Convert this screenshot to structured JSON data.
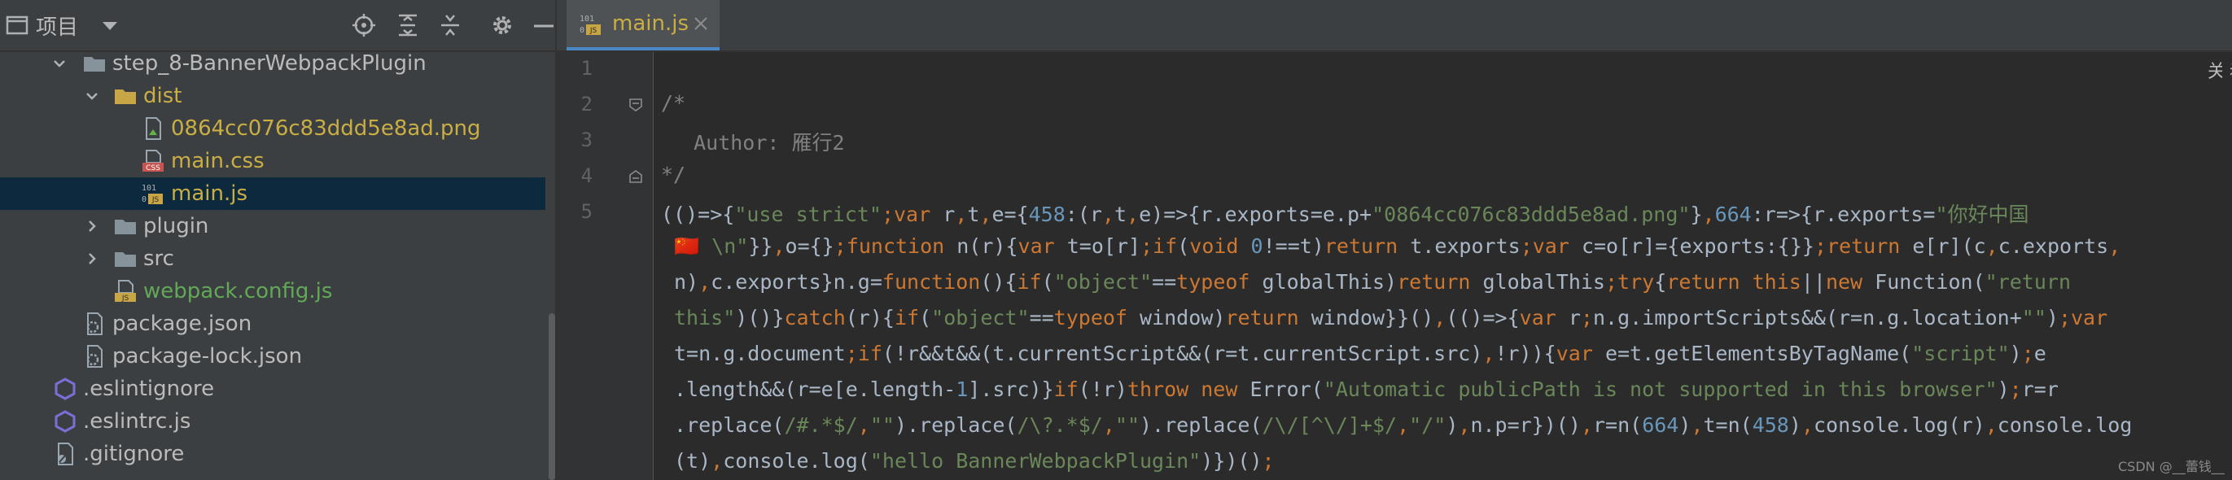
{
  "panel": {
    "title": "项目",
    "toolbar_icons": [
      "locate-icon",
      "expand-all-icon",
      "collapse-all-icon",
      "gear-icon",
      "hide-icon"
    ]
  },
  "tree": [
    {
      "label": "step_8-BannerWebpackPlugin",
      "depth": 1,
      "kind": "folder",
      "expanded": true,
      "color": "default"
    },
    {
      "label": "dist",
      "depth": 2,
      "kind": "folder",
      "expanded": true,
      "color": "yellow"
    },
    {
      "label": "0864cc076c83ddd5e8ad.png",
      "depth": 3,
      "kind": "image-file",
      "color": "yellow"
    },
    {
      "label": "main.css",
      "depth": 3,
      "kind": "css-file",
      "color": "yellow"
    },
    {
      "label": "main.js",
      "depth": 3,
      "kind": "js-file",
      "color": "yellow",
      "selected": true
    },
    {
      "label": "plugin",
      "depth": 2,
      "kind": "folder",
      "expanded": false,
      "color": "default"
    },
    {
      "label": "src",
      "depth": 2,
      "kind": "folder",
      "expanded": false,
      "color": "default"
    },
    {
      "label": "webpack.config.js",
      "depth": 2,
      "kind": "js-file",
      "color": "green"
    },
    {
      "label": "package.json",
      "depth": 1,
      "kind": "json-file",
      "color": "default"
    },
    {
      "label": "package-lock.json",
      "depth": 1,
      "kind": "json-file",
      "color": "default"
    },
    {
      "label": ".eslintignore",
      "depth": 0,
      "kind": "eslint-file",
      "color": "default"
    },
    {
      "label": ".eslintrc.js",
      "depth": 0,
      "kind": "eslint-file",
      "color": "default"
    },
    {
      "label": ".gitignore",
      "depth": 0,
      "kind": "gitignore-file",
      "color": "default"
    }
  ],
  "editor": {
    "tab_label": "main.js",
    "right_hint": "关闭",
    "line_numbers": [
      "1",
      "2",
      "3",
      "4",
      "5"
    ],
    "line1": "",
    "line2": "/*",
    "line3": "  Author: 雁行2",
    "line4": "*/",
    "code_lines": [
      [
        [
          "p",
          "(()=>{"
        ],
        [
          "s",
          "\"use strict\""
        ],
        [
          "k",
          ";var "
        ],
        [
          "p",
          "r"
        ],
        [
          "k",
          ","
        ],
        [
          "p",
          "t"
        ],
        [
          "k",
          ","
        ],
        [
          "p",
          "e={"
        ],
        [
          "n",
          "458"
        ],
        [
          "p",
          ":(r"
        ],
        [
          "k",
          ","
        ],
        [
          "p",
          "t"
        ],
        [
          "k",
          ","
        ],
        [
          "p",
          "e)=>{r.exports=e.p+"
        ],
        [
          "s",
          "\"0864cc076c83ddd5e8ad.png\""
        ],
        [
          "p",
          "}"
        ],
        [
          "k",
          ","
        ],
        [
          "n",
          "664"
        ],
        [
          "p",
          ":r=>{r.exports="
        ],
        [
          "s",
          "\"你好中国"
        ]
      ],
      [
        [
          "s",
          "🇨🇳 \\n\""
        ],
        [
          "p",
          "}}"
        ],
        [
          "k",
          ","
        ],
        [
          "p",
          "o={}"
        ],
        [
          "k",
          ";function "
        ],
        [
          "p",
          "n(r){"
        ],
        [
          "k",
          "var "
        ],
        [
          "p",
          "t=o[r]"
        ],
        [
          "k",
          ";if"
        ],
        [
          "p",
          "("
        ],
        [
          "k",
          "void "
        ],
        [
          "n",
          "0"
        ],
        [
          "p",
          "!==t)"
        ],
        [
          "k",
          "return "
        ],
        [
          "p",
          "t.exports"
        ],
        [
          "k",
          ";var "
        ],
        [
          "p",
          "c=o[r]={exports:{}}"
        ],
        [
          "k",
          ";return "
        ],
        [
          "p",
          "e[r](c"
        ],
        [
          "k",
          ","
        ],
        [
          "p",
          "c.exports"
        ],
        [
          "k",
          ","
        ]
      ],
      [
        [
          "p",
          "n)"
        ],
        [
          "k",
          ","
        ],
        [
          "p",
          "c.exports}n.g="
        ],
        [
          "k",
          "function"
        ],
        [
          "p",
          "(){"
        ],
        [
          "k",
          "if"
        ],
        [
          "p",
          "("
        ],
        [
          "s",
          "\"object\""
        ],
        [
          "p",
          "=="
        ],
        [
          "k",
          "typeof "
        ],
        [
          "p",
          "globalThis)"
        ],
        [
          "k",
          "return "
        ],
        [
          "p",
          "globalThis"
        ],
        [
          "k",
          ";try"
        ],
        [
          "p",
          "{"
        ],
        [
          "k",
          "return this"
        ],
        [
          "p",
          "||"
        ],
        [
          "k",
          "new "
        ],
        [
          "p",
          "Function("
        ],
        [
          "s",
          "\"return"
        ]
      ],
      [
        [
          "s",
          "this\""
        ],
        [
          "p",
          ")()}"
        ],
        [
          "k",
          "catch"
        ],
        [
          "p",
          "(r){"
        ],
        [
          "k",
          "if"
        ],
        [
          "p",
          "("
        ],
        [
          "s",
          "\"object\""
        ],
        [
          "p",
          "=="
        ],
        [
          "k",
          "typeof "
        ],
        [
          "p",
          "window)"
        ],
        [
          "k",
          "return "
        ],
        [
          "p",
          "window}}()"
        ],
        [
          "k",
          ","
        ],
        [
          "p",
          "(()=>{"
        ],
        [
          "k",
          "var "
        ],
        [
          "p",
          "r"
        ],
        [
          "k",
          ";"
        ],
        [
          "p",
          "n.g.importScripts&&(r=n.g.location+"
        ],
        [
          "s",
          "\"\""
        ],
        [
          "p",
          ")"
        ],
        [
          "k",
          ";var"
        ]
      ],
      [
        [
          "p",
          "t=n.g.document"
        ],
        [
          "k",
          ";if"
        ],
        [
          "p",
          "(!r&&t&&(t.currentScript&&(r=t.currentScript.src)"
        ],
        [
          "k",
          ","
        ],
        [
          "p",
          "!r)){"
        ],
        [
          "k",
          "var "
        ],
        [
          "p",
          "e=t.getElementsByTagName("
        ],
        [
          "s",
          "\"script\""
        ],
        [
          "p",
          ")"
        ],
        [
          "k",
          ";"
        ],
        [
          "p",
          "e"
        ]
      ],
      [
        [
          "p",
          ".length&&(r=e[e.length-"
        ],
        [
          "n",
          "1"
        ],
        [
          "p",
          "].src)}"
        ],
        [
          "k",
          "if"
        ],
        [
          "p",
          "(!r)"
        ],
        [
          "k",
          "throw new "
        ],
        [
          "p",
          "Error("
        ],
        [
          "s",
          "\"Automatic publicPath is not supported in this browser\""
        ],
        [
          "p",
          ")"
        ],
        [
          "k",
          ";"
        ],
        [
          "p",
          "r=r"
        ]
      ],
      [
        [
          "p",
          ".replace("
        ],
        [
          "s",
          "/#.*$/"
        ],
        [
          "k",
          ","
        ],
        [
          "s",
          "\"\""
        ],
        [
          "p",
          ").replace("
        ],
        [
          "s",
          "/\\?.*$/"
        ],
        [
          "k",
          ","
        ],
        [
          "s",
          "\"\""
        ],
        [
          "p",
          ").replace("
        ],
        [
          "s",
          "/\\/[^\\/]+$/"
        ],
        [
          "k",
          ","
        ],
        [
          "s",
          "\"/\""
        ],
        [
          "p",
          ")"
        ],
        [
          "k",
          ","
        ],
        [
          "p",
          "n.p=r})()"
        ],
        [
          "k",
          ","
        ],
        [
          "p",
          "r=n("
        ],
        [
          "n",
          "664"
        ],
        [
          "p",
          ")"
        ],
        [
          "k",
          ","
        ],
        [
          "p",
          "t=n("
        ],
        [
          "n",
          "458"
        ],
        [
          "p",
          ")"
        ],
        [
          "k",
          ","
        ],
        [
          "p",
          "console.log(r)"
        ],
        [
          "k",
          ","
        ],
        [
          "p",
          "console.log"
        ]
      ],
      [
        [
          "p",
          "(t)"
        ],
        [
          "k",
          ","
        ],
        [
          "p",
          "console.log("
        ],
        [
          "s",
          "\"hello BannerWebpackPlugin\""
        ],
        [
          "p",
          ")})()"
        ],
        [
          "k",
          ";"
        ]
      ]
    ]
  },
  "watermark": "CSDN @__蕾钱__",
  "colors": {
    "panel_bg": "#3c3f41",
    "editor_bg": "#2b2b2b",
    "selection": "#0d293e",
    "keyword": "#cc7832",
    "string": "#6a8759",
    "number": "#6897bb",
    "comment": "#808080"
  }
}
